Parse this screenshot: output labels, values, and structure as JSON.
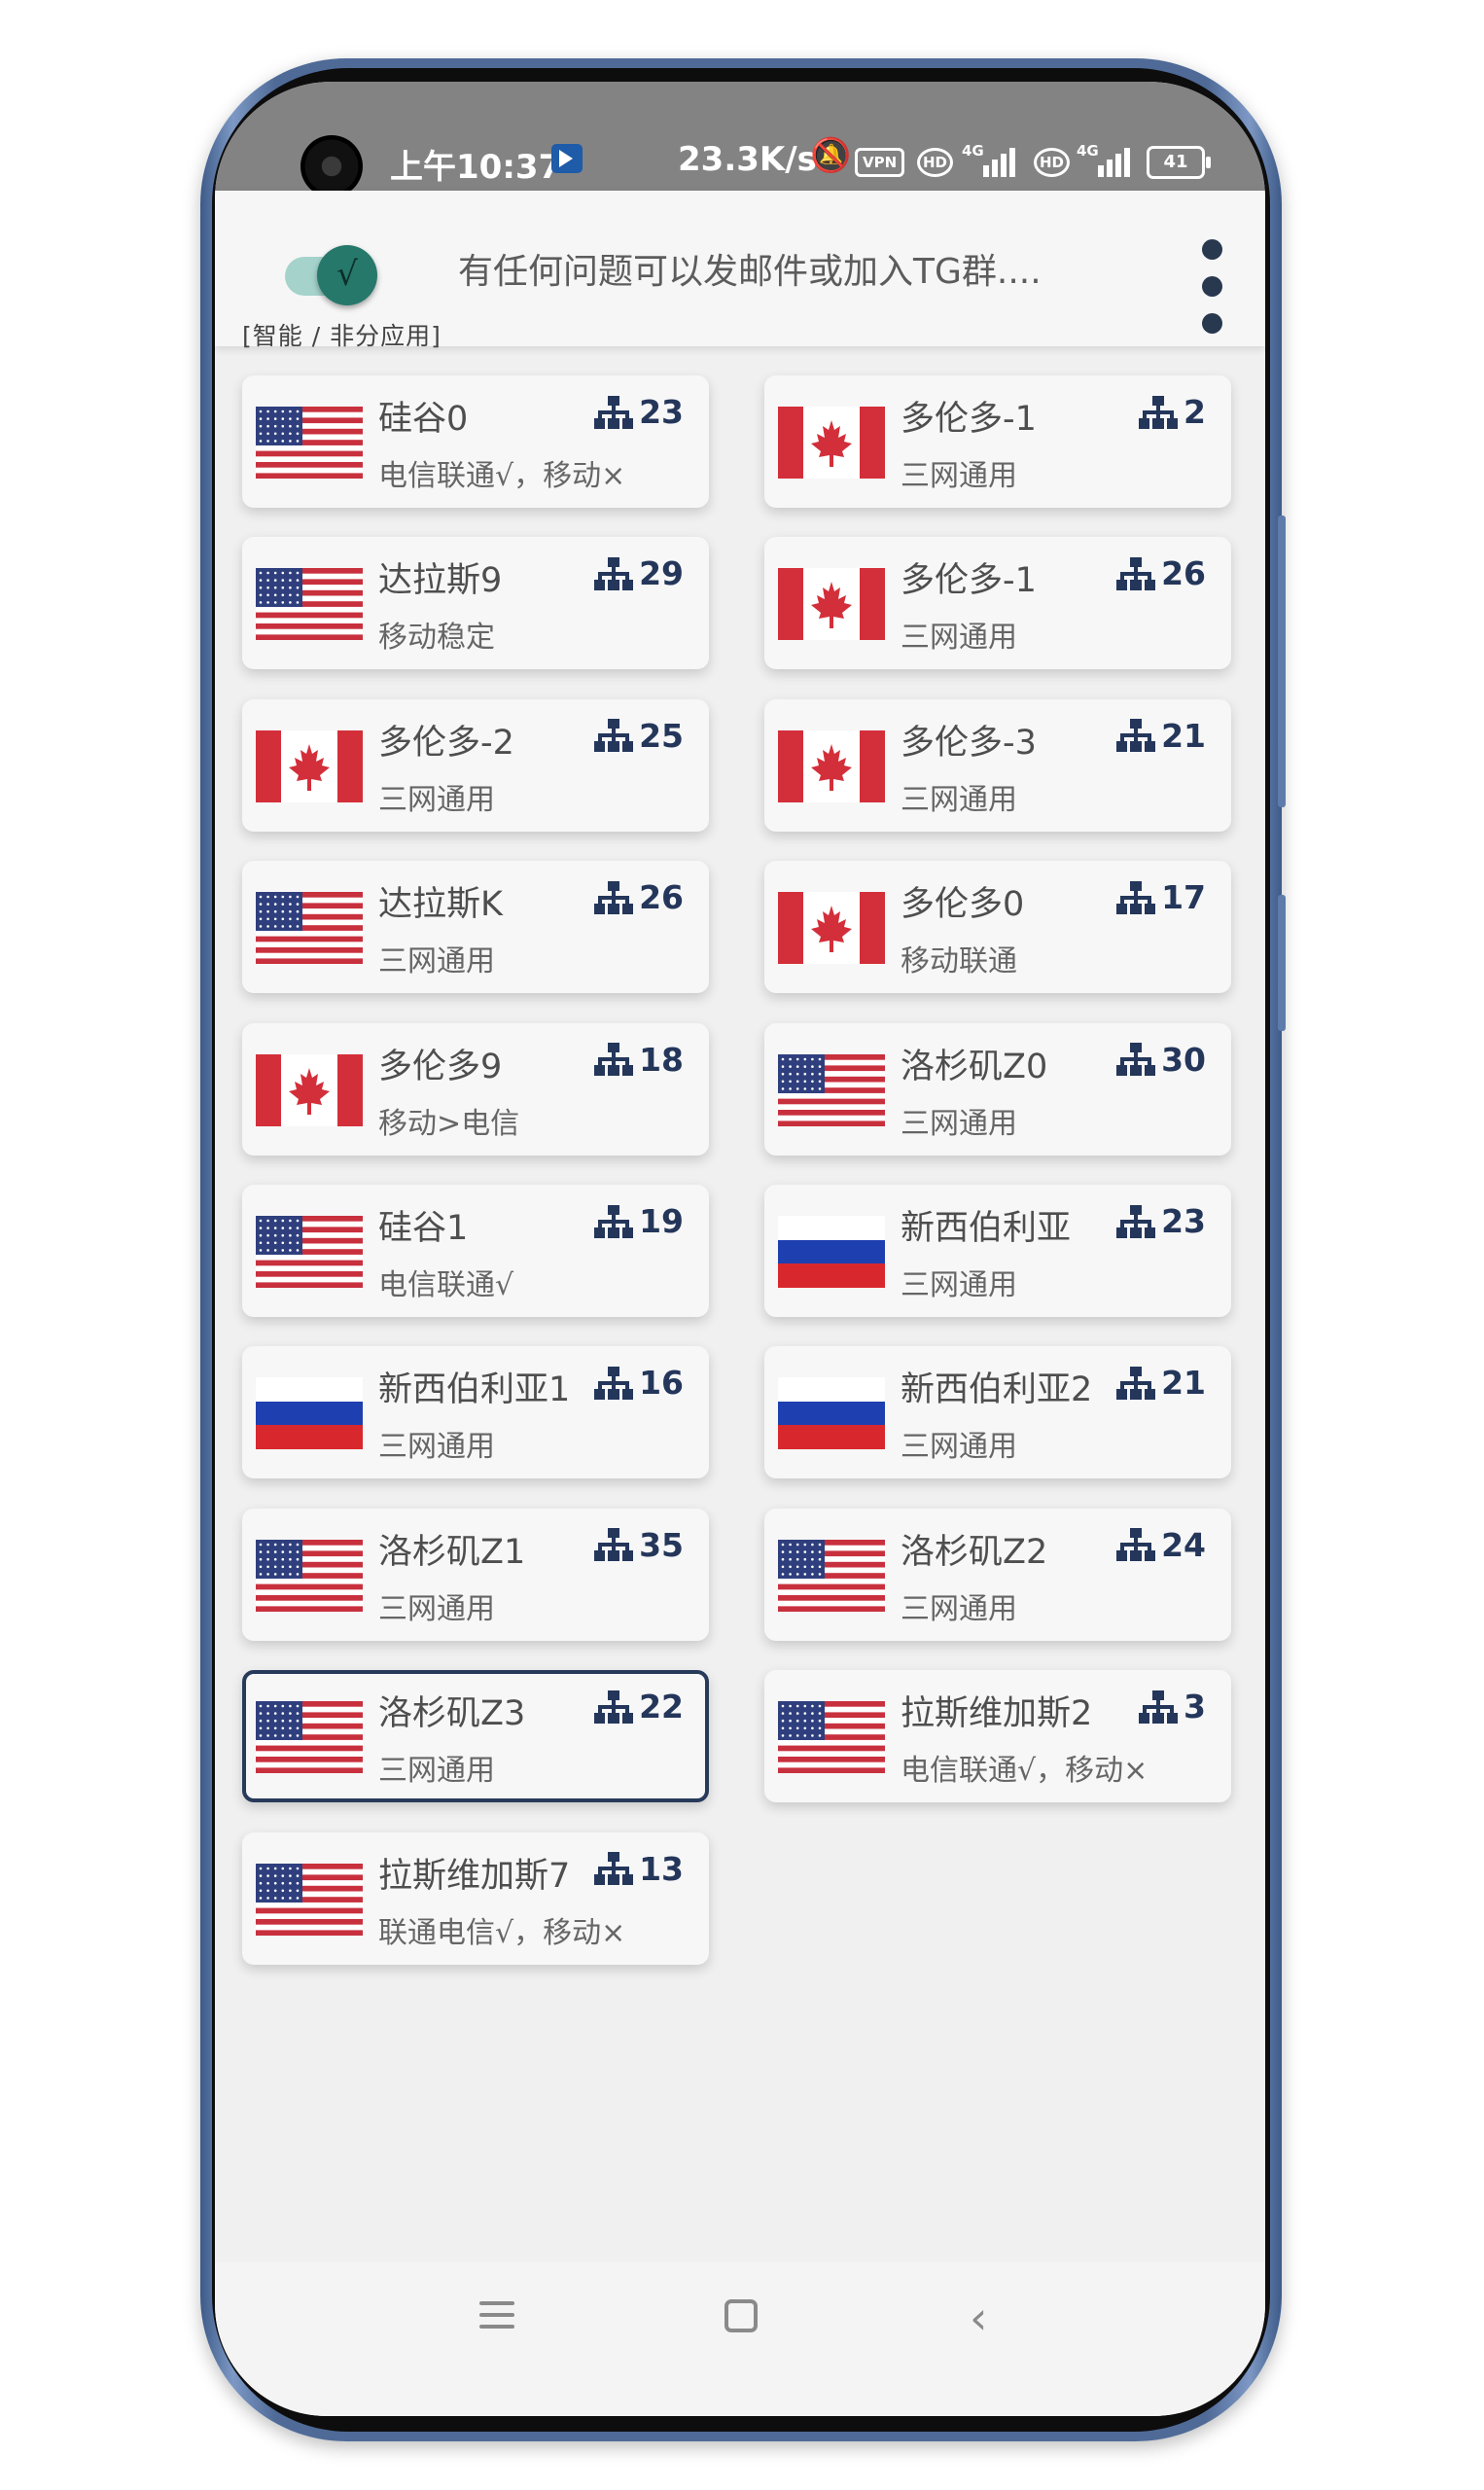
{
  "status_bar": {
    "time": "上午10:37",
    "speed": "23.3K/s",
    "vpn": "VPN",
    "hd": "HD",
    "network": "4G",
    "battery": "41"
  },
  "header": {
    "mode_label": "[智能 / 非分应用]",
    "notice": "有任何问题可以发邮件或加入TG群....",
    "toggle_check": "√",
    "toggle_on": true
  },
  "servers": [
    {
      "name": "硅谷0",
      "desc": "电信联通√，移动×",
      "count": "23",
      "flag": "us"
    },
    {
      "name": "多伦多-1",
      "desc": "三网通用",
      "count": "2",
      "flag": "ca"
    },
    {
      "name": "达拉斯9",
      "desc": "移动稳定",
      "count": "29",
      "flag": "us"
    },
    {
      "name": "多伦多-1",
      "desc": "三网通用",
      "count": "26",
      "flag": "ca"
    },
    {
      "name": "多伦多-2",
      "desc": "三网通用",
      "count": "25",
      "flag": "ca"
    },
    {
      "name": "多伦多-3",
      "desc": "三网通用",
      "count": "21",
      "flag": "ca"
    },
    {
      "name": "达拉斯K",
      "desc": "三网通用",
      "count": "26",
      "flag": "us"
    },
    {
      "name": "多伦多0",
      "desc": "移动联通",
      "count": "17",
      "flag": "ca"
    },
    {
      "name": "多伦多9",
      "desc": "移动>电信",
      "count": "18",
      "flag": "ca"
    },
    {
      "name": "洛杉矶Z0",
      "desc": "三网通用",
      "count": "30",
      "flag": "us"
    },
    {
      "name": "硅谷1",
      "desc": "电信联通√",
      "count": "19",
      "flag": "us"
    },
    {
      "name": "新西伯利亚",
      "desc": "三网通用",
      "count": "23",
      "flag": "ru"
    },
    {
      "name": "新西伯利亚1",
      "desc": "三网通用",
      "count": "16",
      "flag": "ru"
    },
    {
      "name": "新西伯利亚2",
      "desc": "三网通用",
      "count": "21",
      "flag": "ru"
    },
    {
      "name": "洛杉矶Z1",
      "desc": "三网通用",
      "count": "35",
      "flag": "us"
    },
    {
      "name": "洛杉矶Z2",
      "desc": "三网通用",
      "count": "24",
      "flag": "us"
    },
    {
      "name": "洛杉矶Z3",
      "desc": "三网通用",
      "count": "22",
      "flag": "us",
      "selected": true
    },
    {
      "name": "拉斯维加斯2",
      "desc": "电信联通√，移动×",
      "count": "3",
      "flag": "us"
    },
    {
      "name": "拉斯维加斯7",
      "desc": "联通电信√，移动×",
      "count": "13",
      "flag": "us"
    }
  ],
  "colors": {
    "accent": "#26786b",
    "selected_border": "#273a5a",
    "count_text": "#24365a"
  },
  "icons": {
    "network": "network-tree-icon",
    "nav": [
      "menu-icon",
      "home-square-icon",
      "back-chevron-icon"
    ]
  }
}
